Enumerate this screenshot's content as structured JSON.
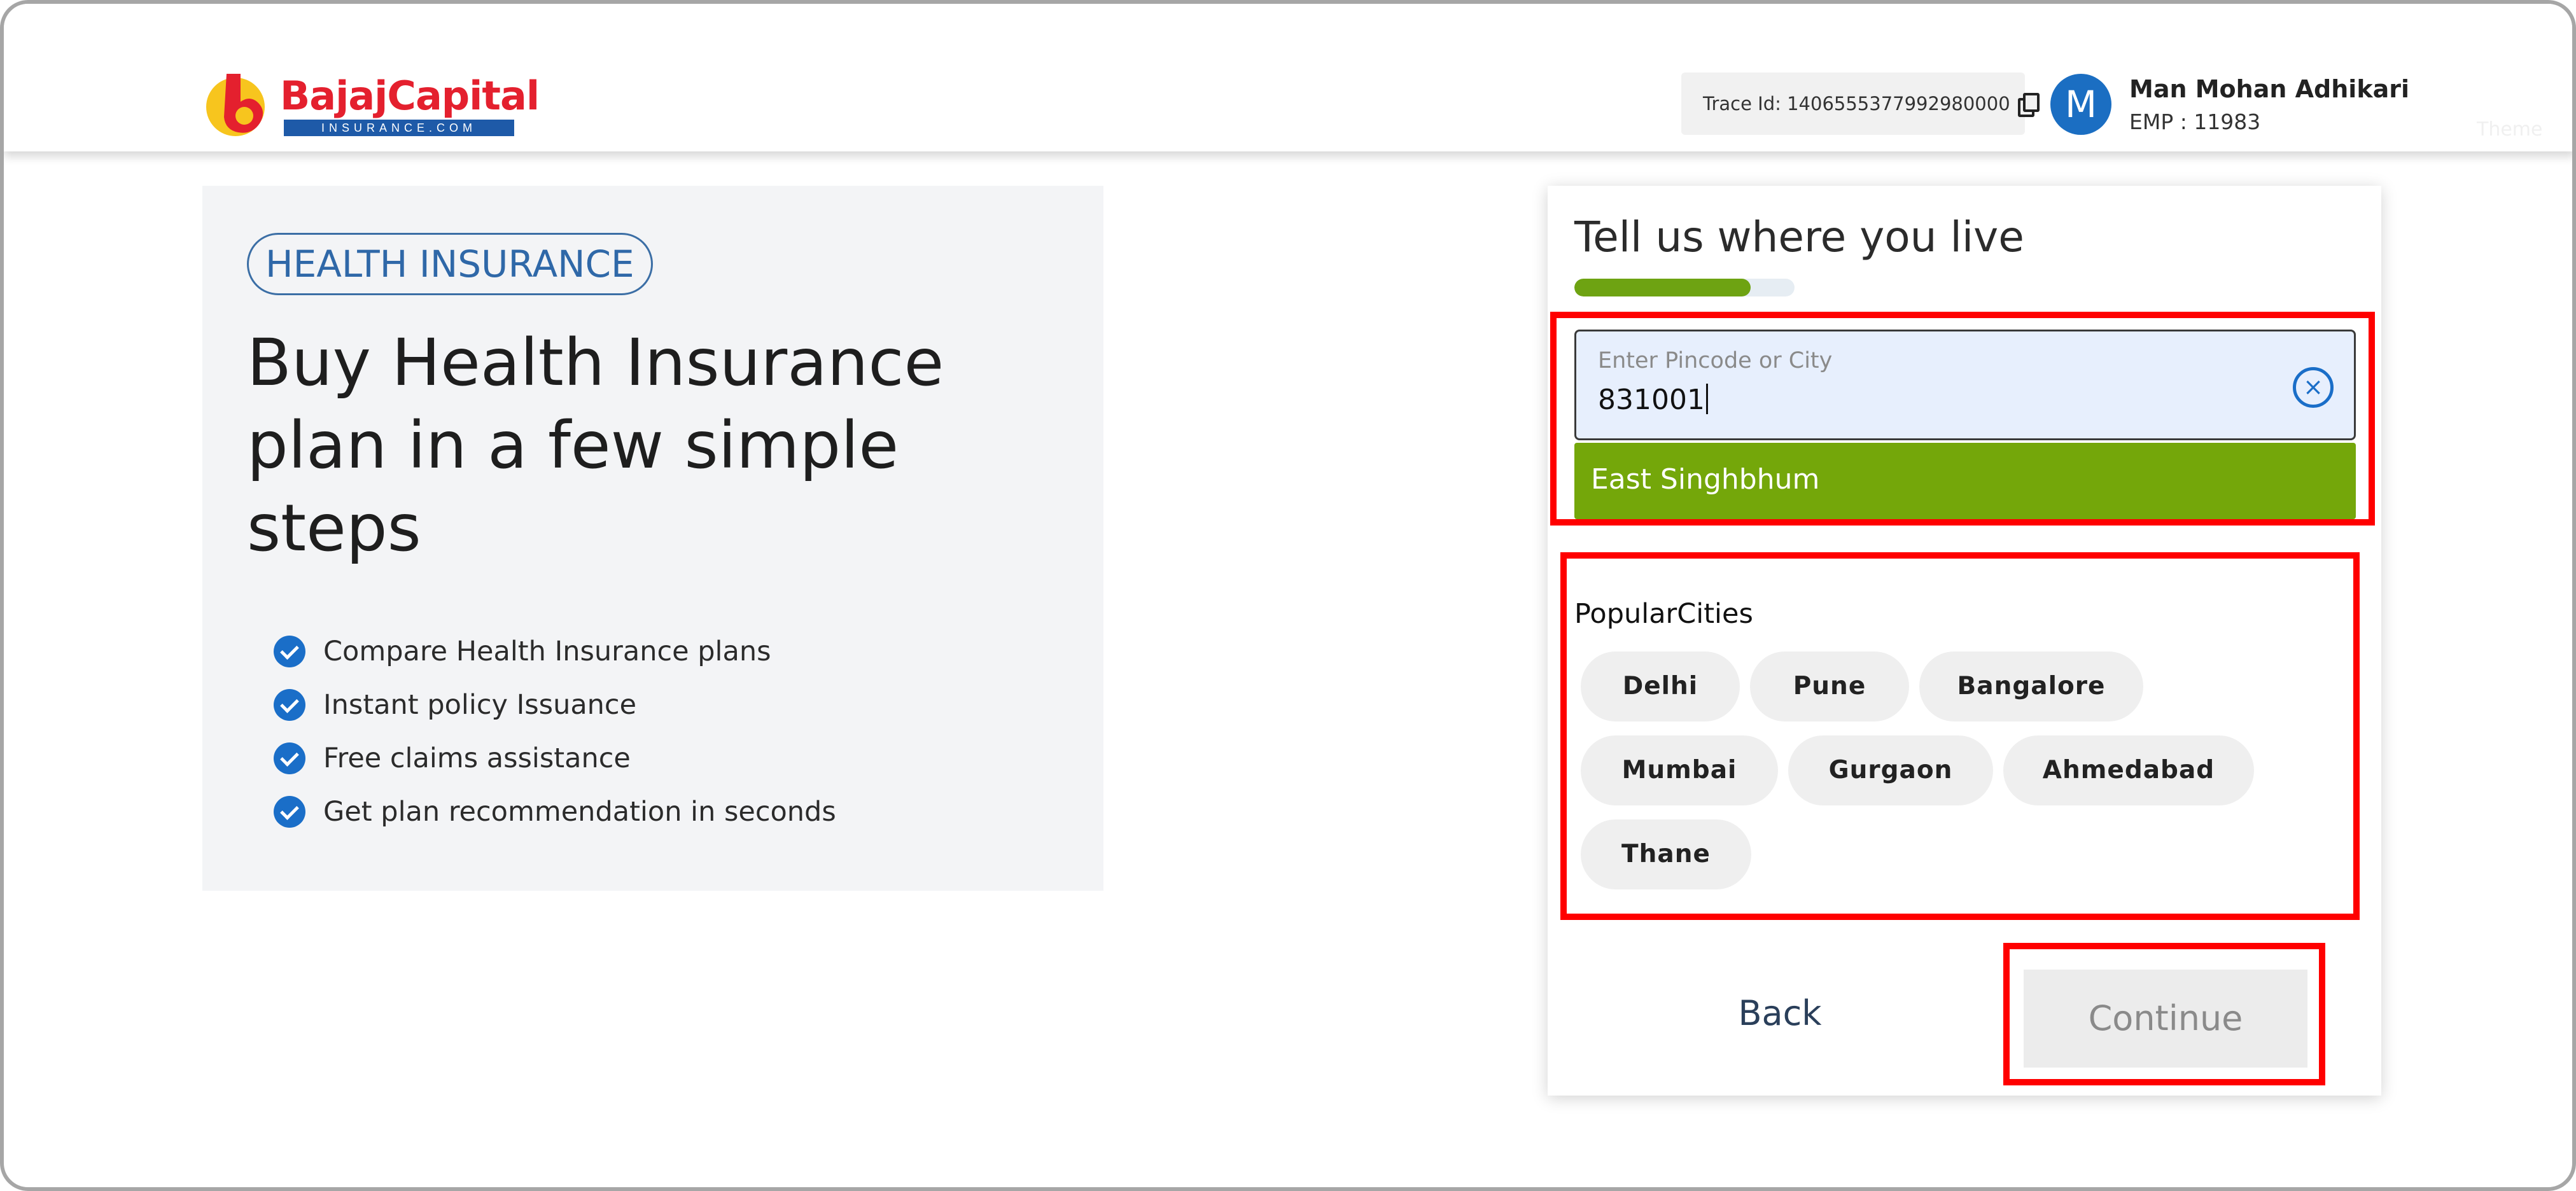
{
  "header": {
    "logo_text": "BajajCapital",
    "logo_subtext": "INSURANCE.COM",
    "trace_id": "Trace Id: 1406555377992980000",
    "user": {
      "initial": "M",
      "name": "Man Mohan Adhikari",
      "emp": "EMP : 11983"
    },
    "theme_label": "Theme"
  },
  "hero": {
    "badge": "HEALTH INSURANCE",
    "title": "Buy Health Insurance plan in a few simple steps",
    "features": [
      "Compare Health Insurance plans",
      "Instant policy Issuance",
      "Free claims assistance",
      "Get plan recommendation in seconds"
    ]
  },
  "card": {
    "title": "Tell us where you live",
    "progress": 0.8,
    "search": {
      "placeholder": "Enter Pincode or City",
      "value": "831001"
    },
    "suggestion": "East Singhbhum",
    "popular_title": "PopularCities",
    "cities": [
      "Delhi",
      "Pune",
      "Bangalore",
      "Mumbai",
      "Gurgaon",
      "Ahmedabad",
      "Thane"
    ],
    "back_label": "Back",
    "continue_label": "Continue"
  },
  "colors": {
    "brand_red": "#e4202e",
    "brand_blue": "#1e5aa8",
    "accent_blue": "#1a6ec8",
    "progress_green": "#6ea312",
    "suggestion_green": "#74a70a",
    "highlight_red": "#ff0000"
  },
  "icons": [
    "copy-icon",
    "check-icon",
    "clear-icon",
    "logo-mark"
  ]
}
